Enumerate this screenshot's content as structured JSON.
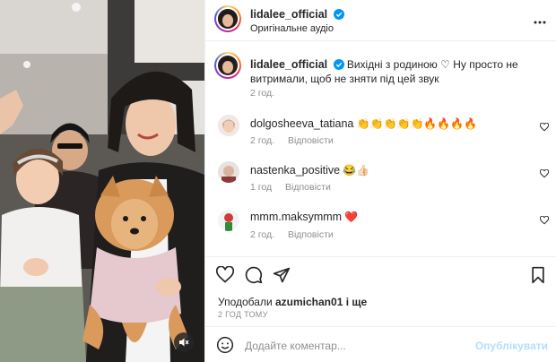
{
  "post": {
    "author": "lidalee_official",
    "audio": "Оригінальне аудіо",
    "caption_user": "lidalee_official",
    "caption_text_line1": "Вихідні з родиною ♡ Ну просто не",
    "caption_text_line2": "витримали, щоб не зняти під цей звук",
    "caption_time": "2 год."
  },
  "comments": [
    {
      "user": "dolgosheeva_tatiana",
      "text": "👏👏👏👏👏🔥🔥🔥🔥",
      "time": "2 год.",
      "reply": "Відповісти"
    },
    {
      "user": "nastenka_positive",
      "text": "😂👍🏻",
      "time": "1 год",
      "reply": "Відповісти"
    },
    {
      "user": "mmm.maksymmm",
      "text": "❤️",
      "time": "2 год.",
      "reply": "Відповісти"
    }
  ],
  "likes": {
    "prefix": "Уподобали",
    "user": "azumichan01",
    "suffix": "і ще",
    "time": "2 ГОД ТОМУ"
  },
  "add_comment": {
    "placeholder": "Додайте коментар...",
    "publish": "Опублікувати"
  },
  "colors": {
    "verified": "#0095f6",
    "heart_red": "#ed4956",
    "publish_disabled": "#b2dffc"
  },
  "icons": [
    "more-icon",
    "verified-icon",
    "heart-icon",
    "comment-icon",
    "share-icon",
    "bookmark-icon",
    "emoji-icon",
    "mute-icon"
  ]
}
